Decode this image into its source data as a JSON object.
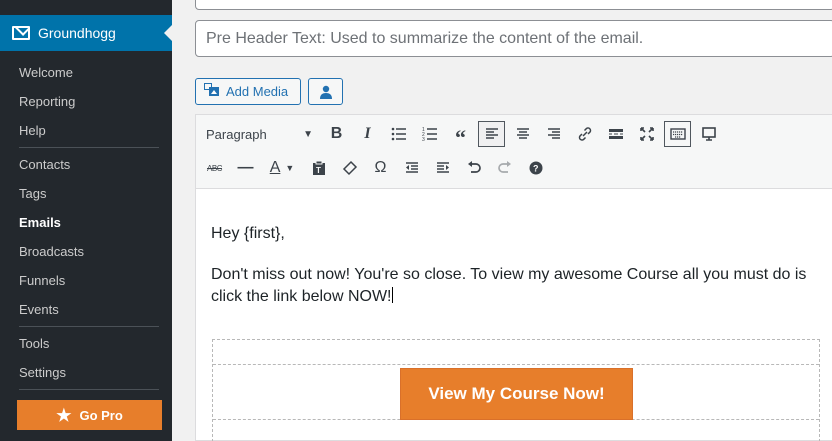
{
  "sidebar": {
    "brand": "Groundhogg",
    "brand_icon": "mail-icon",
    "group1": [
      {
        "label": "Welcome",
        "name": "sidebar-item-welcome",
        "active": false
      },
      {
        "label": "Reporting",
        "name": "sidebar-item-reporting",
        "active": false
      },
      {
        "label": "Help",
        "name": "sidebar-item-help",
        "active": false
      }
    ],
    "group2": [
      {
        "label": "Contacts",
        "name": "sidebar-item-contacts",
        "active": false
      },
      {
        "label": "Tags",
        "name": "sidebar-item-tags",
        "active": false
      },
      {
        "label": "Emails",
        "name": "sidebar-item-emails",
        "active": true
      },
      {
        "label": "Broadcasts",
        "name": "sidebar-item-broadcasts",
        "active": false
      },
      {
        "label": "Funnels",
        "name": "sidebar-item-funnels",
        "active": false
      },
      {
        "label": "Events",
        "name": "sidebar-item-events",
        "active": false
      }
    ],
    "group3": [
      {
        "label": "Tools",
        "name": "sidebar-item-tools",
        "active": false
      },
      {
        "label": "Settings",
        "name": "sidebar-item-settings",
        "active": false
      }
    ],
    "gopro_label": "Go Pro",
    "gopro_icon": "star-icon"
  },
  "email": {
    "preheader_placeholder": "Pre Header Text: Used to summarize the content of the email."
  },
  "media": {
    "add_media_label": "Add Media",
    "user_icon": "user-icon"
  },
  "toolbar": {
    "format_select": "Paragraph"
  },
  "body": {
    "greeting": "Hey {first},",
    "paragraph": "Don't miss out now! You're so close. To view my awesome Course all you must do is click the link below NOW!",
    "cta_label": "View My Course Now!"
  },
  "colors": {
    "sidebar_bg": "#23282d",
    "accent_blue": "#0073aa",
    "brand_orange": "#e77e2b"
  }
}
